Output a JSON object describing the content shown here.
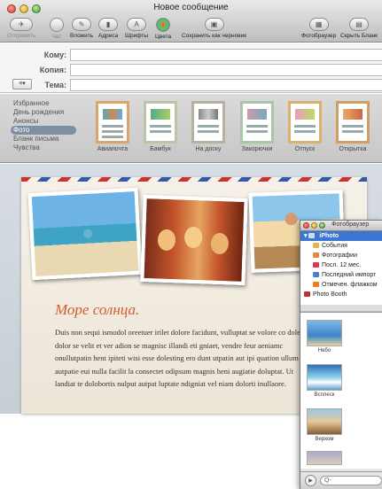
{
  "window": {
    "title": "Новое сообщение"
  },
  "toolbar": {
    "send": "Отправить",
    "chat": "Чат",
    "attach": "Вложить",
    "address": "Адреса",
    "fonts": "Шрифты",
    "colors": "Цвета",
    "save_draft": "Сохранить как черновик",
    "photo_browser": "Фотобраузер",
    "hide_stationery": "Скрыть Бланк"
  },
  "headers": {
    "to": "Кому:",
    "cc": "Копия:",
    "subject": "Тема:"
  },
  "stationery": {
    "categories": [
      "Избранное",
      "День рождения",
      "Анонсы",
      "Фото",
      "Бланк письма",
      "Чувства"
    ],
    "active_category": "Фото",
    "templates": [
      "Авиапочта",
      "Бамбук",
      "На доску",
      "Закорючки",
      "Отпуск",
      "Открытка"
    ]
  },
  "message": {
    "title": "Море солнца.",
    "body": "Duis non sequi ismodol oreetuer irilet dolore facidunt, vulluptat se volore co dolesed dolor se velit et ver adion se magnisc illandi eti gniaet, vendre feur aeniamc onullutpatin hent ipiteti wisi esse dolesting ero dunt utpatin aut ipi quation ullum ea autpatie eui nulla facilit la consectet odipsum magnis heni augiatie doluptat. Ut landiat te dolobortis nulput autpat luptate ndigniat vel niam dolorti inullaore."
  },
  "photo_browser": {
    "title": "Фотобраузер",
    "source_header": "iPhoto",
    "sources": [
      "События",
      "Фотографии",
      "Посл. 12 мес.",
      "Последний импорт",
      "Отмечен. флажком",
      "Photo Booth"
    ],
    "thumbnails": [
      "Небо",
      "Всплеск",
      "Верхом"
    ],
    "search_placeholder": "Q-"
  }
}
